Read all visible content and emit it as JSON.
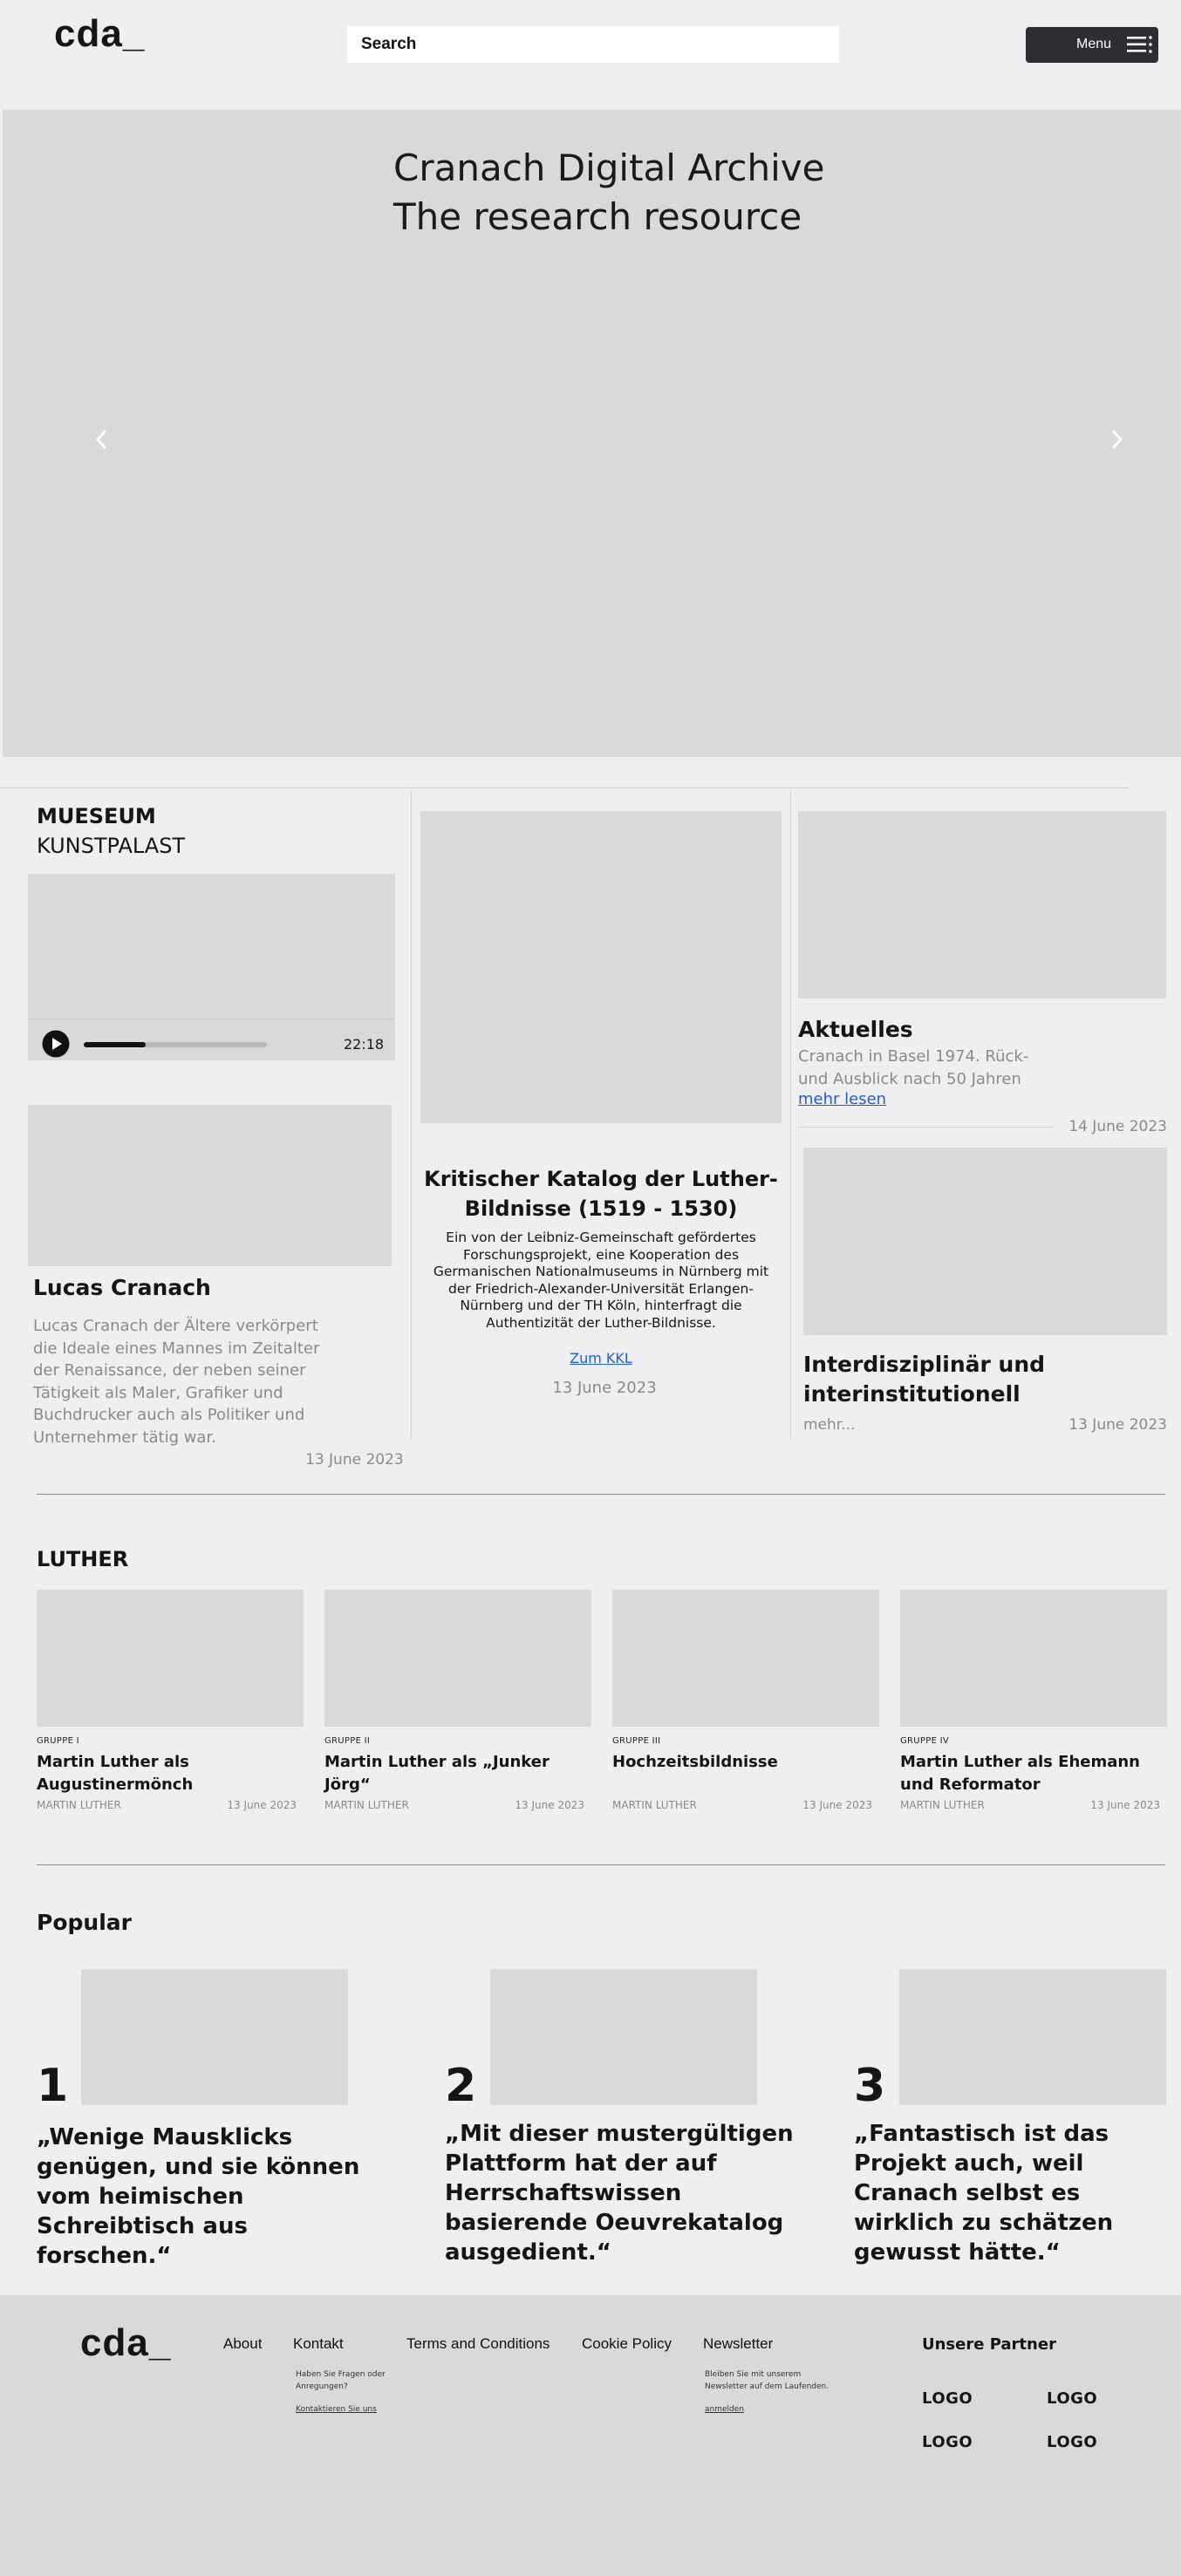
{
  "header": {
    "logo": "cda_",
    "search_placeholder": "Search",
    "menu_label": "Menu"
  },
  "hero": {
    "title_line1": "Cranach Digital Archive",
    "title_line2": "The research resource"
  },
  "museum": {
    "name_bold": "MUESEUM",
    "name_light": "KUNSTPALAST",
    "video_time": "22:18",
    "video_progress": 0.34
  },
  "lucas": {
    "title": "Lucas Cranach",
    "text": "Lucas Cranach der Ältere verkörpert die Ideale eines Mannes im Zeitalter der Renaissance, der neben seiner Tätigkeit als Maler, Grafiker und Buchdrucker auch als Politiker und Unternehmer tätig war.",
    "date": "13 June 2023"
  },
  "kkl": {
    "title": "Kritischer Katalog der Luther-Bildnisse (1519 - 1530)",
    "text": "Ein von der Leibniz-Gemeinschaft gefördertes Forschungsprojekt, eine Kooperation des Germanischen Nationalmuseums in Nürnberg mit der Friedrich-Alexander-Universität Erlangen-Nürnberg und der TH Köln, hinterfragt die Authentizität der Luther-Bildnisse.",
    "link": "Zum KKL",
    "date": "13 June 2023"
  },
  "aktuelles": {
    "title": "Aktuelles",
    "text": "Cranach in Basel 1974. Rück- und Ausblick nach 50 Jahren",
    "link": "mehr lesen",
    "date": "14 June 2023"
  },
  "inter": {
    "title": "Interdisziplinär und interinstitutionell",
    "more": "mehr...",
    "date": "13 June 2023"
  },
  "luther": {
    "heading": "LUTHER",
    "cards": [
      {
        "group": "GRUPPE I",
        "title": "Martin Luther als Augustinermönch",
        "category": "MARTIN LUTHER",
        "date": "13 June 2023"
      },
      {
        "group": "GRUPPE II",
        "title": "Martin Luther als „Junker Jörg“",
        "category": "MARTIN LUTHER",
        "date": "13 June 2023"
      },
      {
        "group": "GRUPPE III",
        "title": "Hochzeitsbildnisse",
        "category": "MARTIN LUTHER",
        "date": "13 June 2023"
      },
      {
        "group": "GRUPPE IV",
        "title": " Martin Luther als Ehemann und Reformator",
        "category": "MARTIN LUTHER",
        "date": "13 June 2023"
      }
    ]
  },
  "popular": {
    "heading": "Popular",
    "items": [
      {
        "num": "1",
        "quote": "„Wenige Mausklicks genügen, und sie können vom heimischen Schreibtisch aus forschen.“"
      },
      {
        "num": "2",
        "quote": "„Mit dieser mustergültigen Plattform hat der auf Herrschaftswissen basierende Oeuvrekatalog ausgedient.“"
      },
      {
        "num": "3",
        "quote": "„Fantastisch ist das Projekt auch, weil Cranach selbst es wirklich zu schätzen gewusst hätte.“"
      }
    ]
  },
  "footer": {
    "logo": "cda_",
    "nav": [
      "About",
      "Kontakt",
      "Terms and Conditions",
      "Cookie Policy",
      "Newsletter"
    ],
    "kontakt_text": "Haben Sie Fragen oder Anregungen?",
    "kontakt_link": "Kontaktieren Sie uns",
    "newsletter_text": "Bleiben Sie mit unserem Newsletter auf dem Laufenden.",
    "newsletter_link": "anmelden",
    "partner_heading": "Unsere Partner",
    "partner_logos": [
      "LOGO",
      "LOGO",
      "LOGO",
      "LOGO"
    ]
  }
}
